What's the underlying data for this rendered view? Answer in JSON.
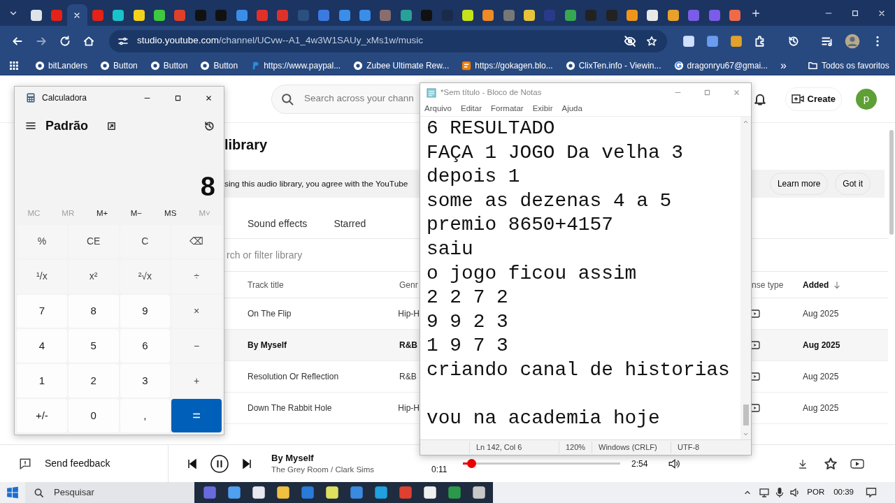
{
  "browser": {
    "tabs": [
      {
        "color": "#dfe3ea",
        "selected": false
      },
      {
        "color": "#e62117",
        "selected": false
      },
      {
        "selected": true
      },
      {
        "color": "#e62117",
        "selected": false
      },
      {
        "color": "#19c3c9",
        "selected": false
      },
      {
        "color": "#f2d21b",
        "selected": false
      },
      {
        "color": "#3ec93e",
        "selected": false
      },
      {
        "color": "#e0402a",
        "selected": false
      },
      {
        "color": "#111111",
        "selected": false
      },
      {
        "color": "#111111",
        "selected": false
      },
      {
        "color": "#3b8ee8",
        "selected": false
      },
      {
        "color": "#e0302a",
        "selected": false
      },
      {
        "color": "#e0302a",
        "selected": false
      },
      {
        "color": "#2b4f7e",
        "selected": false
      },
      {
        "color": "#3b7be0",
        "selected": false
      },
      {
        "color": "#3b8ee8",
        "selected": false
      },
      {
        "color": "#3b8ee8",
        "selected": false
      },
      {
        "color": "#8a6d6d",
        "selected": false
      },
      {
        "color": "#2aa198",
        "selected": false
      },
      {
        "color": "#111111",
        "selected": false
      },
      {
        "color": "#1a2a4a",
        "selected": false
      },
      {
        "color": "#c6e21a",
        "selected": false
      },
      {
        "color": "#f08a24",
        "selected": false
      },
      {
        "color": "#777777",
        "selected": false
      },
      {
        "color": "#e8c33a",
        "selected": false
      },
      {
        "color": "#2a3a8a",
        "selected": false
      },
      {
        "color": "#36a852",
        "selected": false
      },
      {
        "color": "#222222",
        "selected": false
      },
      {
        "color": "#222222",
        "selected": false
      },
      {
        "color": "#f0951a",
        "selected": false
      },
      {
        "color": "#e8e8e8",
        "selected": false
      },
      {
        "color": "#e8a22a",
        "selected": false
      },
      {
        "color": "#7b5ce8",
        "selected": false
      },
      {
        "color": "#7b5ce8",
        "selected": false
      },
      {
        "color": "#f06a4a",
        "selected": false
      }
    ],
    "address": {
      "host": "studio.youtube.com",
      "path": "/channel/UCvw--A1_4w3W1SAUy_xMs1w/music"
    },
    "bookmarks": [
      {
        "label": "bitLanders",
        "kind": "site"
      },
      {
        "label": "Button",
        "kind": "site"
      },
      {
        "label": "Button",
        "kind": "site"
      },
      {
        "label": "Button",
        "kind": "site"
      },
      {
        "label": "https://www.paypal...",
        "kind": "paypal"
      },
      {
        "label": "Zubee Ultimate Rew...",
        "kind": "site"
      },
      {
        "label": "https://gokagen.blo...",
        "kind": "blogger"
      },
      {
        "label": "ClixTen.info - Viewin...",
        "kind": "site"
      },
      {
        "label": "dragonryu67@gmai...",
        "kind": "google"
      }
    ],
    "bookmarks_more": "»",
    "all_bookmarks": "Todos os favoritos"
  },
  "studio": {
    "search_placeholder": "Search across your chann",
    "create": "Create",
    "avatar": "p",
    "title": "library",
    "notice": "sing this audio library, you agree with the YouTube",
    "notice_buttons": [
      "Learn more",
      "Got it"
    ],
    "tabs": [
      {
        "label": "Sound effects",
        "selected": false
      },
      {
        "label": "Starred",
        "selected": false
      }
    ],
    "filter_placeholder": "rch or filter library",
    "columns": [
      "Track title",
      "Genr",
      "nse type",
      "Added"
    ],
    "rows": [
      {
        "title": "On The Flip",
        "genre": "Hip-H",
        "added": "Aug 2025",
        "selected": false
      },
      {
        "title": "By Myself",
        "genre": "R&B",
        "added": "Aug 2025",
        "selected": true
      },
      {
        "title": "Resolution Or Reflection",
        "genre": "R&B",
        "added": "Aug 2025",
        "selected": false
      },
      {
        "title": "Down The Rabbit Hole",
        "genre": "Hip-H",
        "added": "Aug 2025",
        "selected": false
      }
    ]
  },
  "player": {
    "feedback": "Send feedback",
    "title": "By Myself",
    "artist": "The Grey Room / Clark Sims",
    "elapsed": "0:11",
    "duration": "2:54",
    "level": 0.03
  },
  "calculator": {
    "title": "Calculadora",
    "mode": "Padrão",
    "display": "8",
    "memory": [
      {
        "label": "MC",
        "disabled": true
      },
      {
        "label": "MR",
        "disabled": true
      },
      {
        "label": "M+",
        "disabled": false
      },
      {
        "label": "M−",
        "disabled": false
      },
      {
        "label": "MS",
        "disabled": false
      },
      {
        "label": "M˅",
        "disabled": true
      }
    ],
    "keys": [
      {
        "label": "%",
        "kind": "op"
      },
      {
        "label": "CE",
        "kind": "op"
      },
      {
        "label": "C",
        "kind": "op"
      },
      {
        "label": "⌫",
        "kind": "op"
      },
      {
        "label": "¹/x",
        "kind": "op"
      },
      {
        "label": "x²",
        "kind": "op"
      },
      {
        "label": "²√x",
        "kind": "op"
      },
      {
        "label": "÷",
        "kind": "op"
      },
      {
        "label": "7",
        "kind": "digit"
      },
      {
        "label": "8",
        "kind": "digit"
      },
      {
        "label": "9",
        "kind": "digit"
      },
      {
        "label": "×",
        "kind": "op"
      },
      {
        "label": "4",
        "kind": "digit"
      },
      {
        "label": "5",
        "kind": "digit"
      },
      {
        "label": "6",
        "kind": "digit"
      },
      {
        "label": "−",
        "kind": "op"
      },
      {
        "label": "1",
        "kind": "digit"
      },
      {
        "label": "2",
        "kind": "digit"
      },
      {
        "label": "3",
        "kind": "digit"
      },
      {
        "label": "+",
        "kind": "op"
      },
      {
        "label": "+/-",
        "kind": "digit"
      },
      {
        "label": "0",
        "kind": "digit"
      },
      {
        "label": ",",
        "kind": "digit"
      },
      {
        "label": "=",
        "kind": "equals"
      }
    ]
  },
  "notepad": {
    "title": "*Sem título - Bloco de Notas",
    "menu": [
      "Arquivo",
      "Editar",
      "Formatar",
      "Exibir",
      "Ajuda"
    ],
    "lines": [
      {
        "text": "6 RESULTADO"
      },
      {
        "text": "FAÇA 1 JOGO Da velha 3"
      },
      {
        "text": "depois 1"
      },
      {
        "text": "some as dezenas 4 a 5"
      },
      {
        "text": "premio 8650+4157"
      },
      {
        "text": "saiu"
      },
      {
        "text": "o jogo ficou assim"
      },
      {
        "text": "2 2 7 2"
      },
      {
        "text": "9 9 2 3"
      },
      {
        "text": "1 9 7 3"
      },
      {
        "text": "criando canal de historias"
      },
      {
        "text": "vou na academia hoje",
        "blank_before": true
      }
    ],
    "status": [
      "Ln 142, Col 6",
      "120%",
      "Windows (CRLF)",
      "UTF-8"
    ]
  },
  "taskbar": {
    "search_placeholder": "Pesquisar",
    "language": "POR",
    "time": "00:39"
  }
}
